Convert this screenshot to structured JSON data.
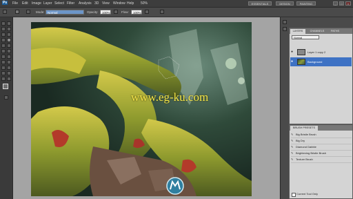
{
  "menubar": {
    "app_icon": "Ps",
    "items": [
      "File",
      "Edit",
      "Image",
      "Layer",
      "Select",
      "Filter",
      "Analysis",
      "3D",
      "View",
      "Window",
      "Help"
    ],
    "zoom": "50%",
    "workspace_button": "ESSENTIALS",
    "secondary_button": "DESIGN",
    "tertiary_button": "PAINTING"
  },
  "options": {
    "mode_label": "Mode:",
    "mode_value": "Normal",
    "opacity_label": "Opacity:",
    "opacity_value": "100%",
    "flow_label": "Flow:",
    "flow_value": "100%"
  },
  "layers_panel": {
    "tabs": [
      "LAYERS",
      "CHANNELS",
      "PATHS"
    ],
    "blend_mode": "Normal",
    "layers": [
      {
        "name": "Layer 1 copy 2"
      },
      {
        "name": "Background"
      }
    ]
  },
  "actions_panel": {
    "title": "BRUSH PRESETS",
    "items": [
      "Big Bristle Brush",
      "Big Dry",
      "Diamond Dabble",
      "Brightening Bristle Brush",
      "Texture Brush"
    ],
    "footer": "Current Tool Only"
  },
  "canvas": {
    "watermark_text": "www.eg-ku.com"
  },
  "icons": {
    "layer_visibility": "eye-icon",
    "action_item": "brush-icon"
  },
  "colors": {
    "accent": "#6c95c8",
    "watermark": "#f0e34a"
  }
}
